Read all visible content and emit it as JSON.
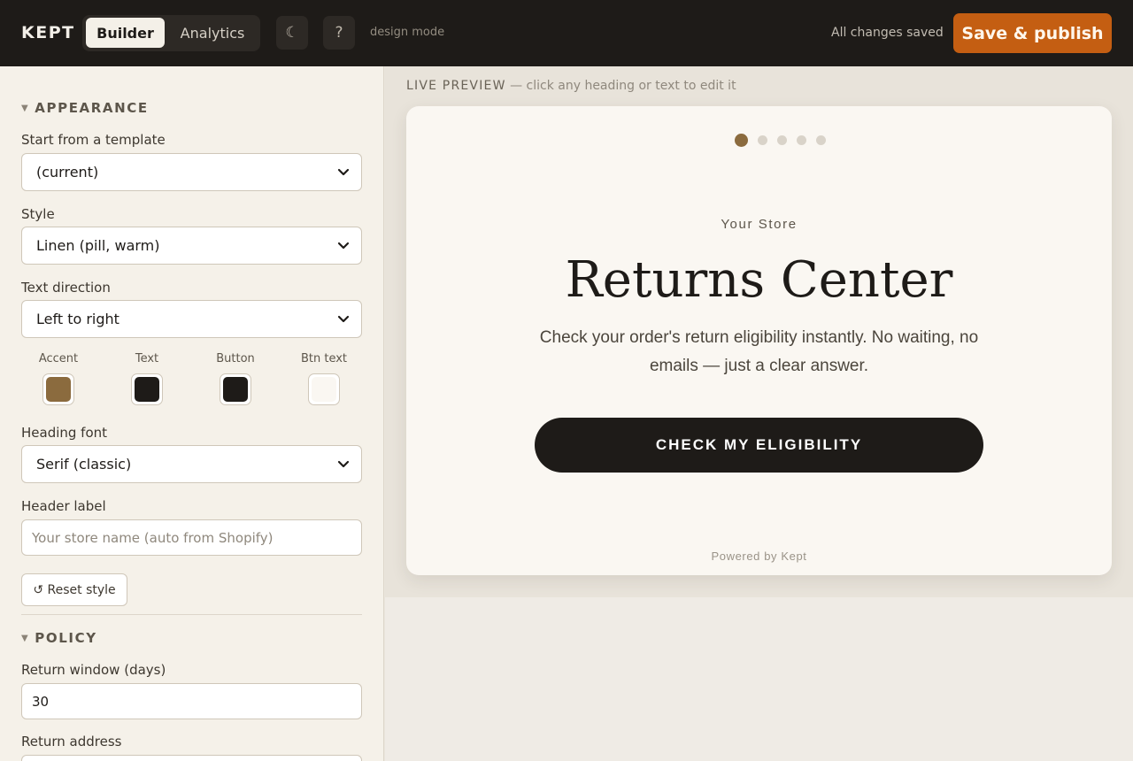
{
  "header": {
    "brand": "KEPT",
    "tabs": [
      {
        "label": "Builder",
        "active": true
      },
      {
        "label": "Analytics",
        "active": false
      }
    ],
    "theme_icon": "moon-icon",
    "theme_glyph": "☾",
    "help_glyph": "?",
    "mode_label": "design mode",
    "saved_status": "All changes saved",
    "publish_label": "Save & publish"
  },
  "sidebar": {
    "appearance": {
      "title": "APPEARANCE",
      "template_label": "Start from a template",
      "template_value": "(current)",
      "style_label": "Style",
      "style_value": "Linen (pill, warm)",
      "direction_label": "Text direction",
      "direction_value": "Left to right",
      "colors": [
        {
          "label": "Accent",
          "value": "#8b6b3e"
        },
        {
          "label": "Text",
          "value": "#1e1b18"
        },
        {
          "label": "Button",
          "value": "#1e1b18"
        },
        {
          "label": "Btn text",
          "value": "#faf7f2"
        }
      ],
      "heading_font_label": "Heading font",
      "heading_font_value": "Serif (classic)",
      "header_label_label": "Header label",
      "header_label_placeholder": "Your store name (auto from Shopify)",
      "reset_label": "↺ Reset style"
    },
    "policy": {
      "title": "POLICY",
      "window_label": "Return window (days)",
      "window_value": "30",
      "address_label": "Return address"
    }
  },
  "preview": {
    "heading_strong": "LIVE PREVIEW",
    "heading_rest": " — click any heading or text to edit it",
    "steps_total": 5,
    "steps_active": 1,
    "store_label": "Your Store",
    "title": "Returns Center",
    "subtitle": "Check your order's return eligibility instantly. No waiting, no emails — just a clear answer.",
    "cta_label": "CHECK MY ELIGIBILITY",
    "footer": "Powered by Kept"
  },
  "colors": {
    "accent": "#8b6b3e",
    "publish": "#c45e12",
    "topbar": "#1e1b18"
  }
}
